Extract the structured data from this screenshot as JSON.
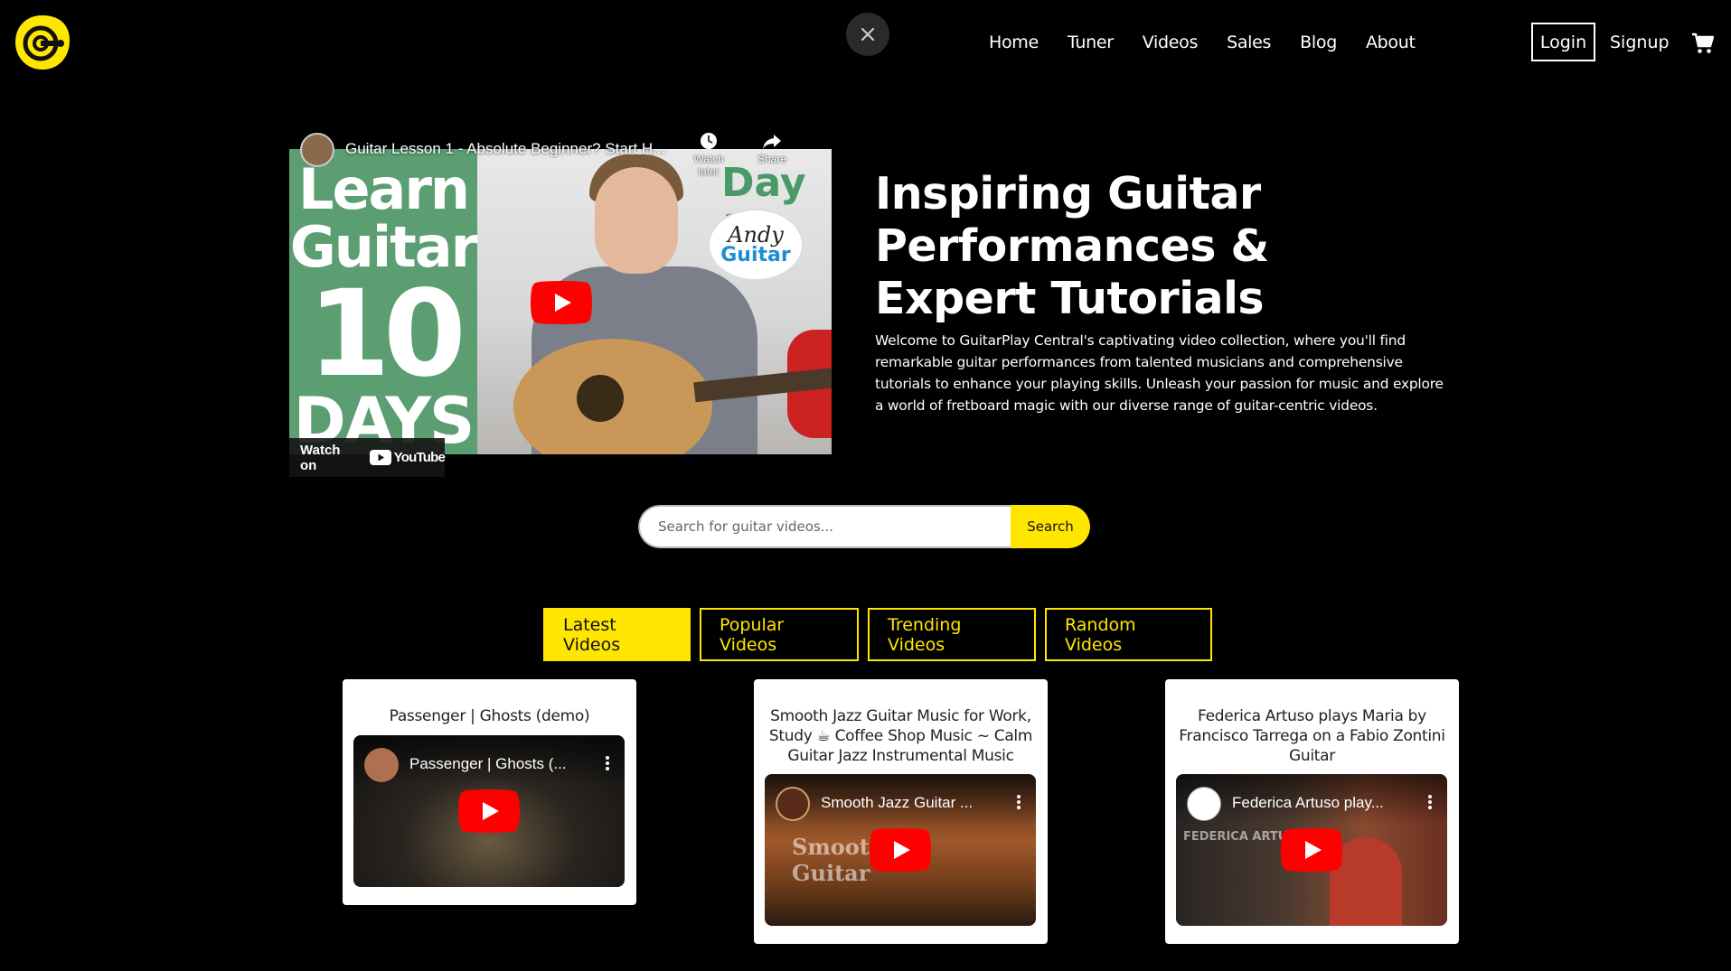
{
  "header": {
    "close_symbol": "×",
    "nav": [
      "Home",
      "Tuner",
      "Videos",
      "Sales",
      "Blog",
      "About"
    ],
    "login_label": "Login",
    "signup_label": "Signup",
    "brand_color": "#ffe600",
    "icons": [
      "logo-icon",
      "close-icon",
      "cart-icon"
    ]
  },
  "hero_video": {
    "title": "Guitar Lesson 1 - Absolute Beginner? Start H...",
    "watch_later": "Watch later",
    "share": "Share",
    "watch_on": "Watch on",
    "youtube": "YouTube",
    "thumb_words": [
      "Learn",
      "Guitar",
      "10",
      "DAYS"
    ],
    "day_label": "Day 1",
    "badge_line1": "Andy",
    "badge_line2": "Guitar"
  },
  "hero": {
    "title": "Inspiring Guitar Performances & Expert Tutorials",
    "description": "Welcome to GuitarPlay Central's captivating video collection, where you'll find remarkable guitar performances from talented musicians and comprehensive tutorials to enhance your playing skills. Unleash your passion for music and explore a world of fretboard magic with our diverse range of guitar-centric videos."
  },
  "search": {
    "placeholder": "Search for guitar videos...",
    "button_label": "Search"
  },
  "tabs": [
    {
      "label": "Latest Videos",
      "active": true
    },
    {
      "label": "Popular Videos",
      "active": false
    },
    {
      "label": "Trending Videos",
      "active": false
    },
    {
      "label": "Random Videos",
      "active": false
    }
  ],
  "cards": [
    {
      "title": "Passenger | Ghosts (demo)",
      "video_title": "Passenger | Ghosts (..."
    },
    {
      "title": "Smooth Jazz Guitar Music for Work, Study ☕ Coffee Shop Music ~ Calm Guitar Jazz Instrumental Music",
      "video_title": "Smooth Jazz Guitar ...",
      "overlay": "Smooth Guitar"
    },
    {
      "title": "Federica Artuso plays Maria by Francisco Tarrega on a Fabio Zontini Guitar",
      "video_title": "Federica Artuso play...",
      "overlay": "FEDERICA ARTU"
    }
  ]
}
